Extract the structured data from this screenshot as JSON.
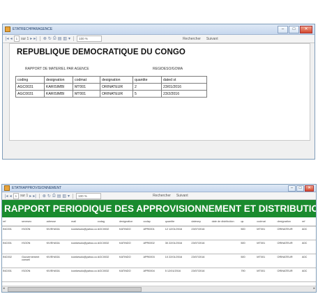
{
  "window1": {
    "title": "ETATRECHPARAGENCE",
    "toolbar": {
      "page_cur": "1",
      "page_total": "sur 1",
      "zoom": "100 %",
      "find": "Rechercher",
      "next": "Suivant"
    },
    "report": {
      "heading": "REPUBLIQUE DEMOCRATIQUE DU CONGO",
      "sub_left": "RAPPORT DE MATERIEL PAR AGENCE",
      "sub_right": "REGIDESO/GOMA",
      "columns": [
        "coding",
        "designation",
        "codmat",
        "designation",
        "quantite",
        "dated st"
      ],
      "rows": [
        [
          "AGC0031",
          "KARISIMBI",
          "MT001",
          "ORINATEUR",
          "2",
          "23/01/2016"
        ],
        [
          "AGC0031",
          "KARISIMBI",
          "MT001",
          "ORINATEUR",
          "5",
          "23/2/2016"
        ]
      ]
    }
  },
  "window2": {
    "title": "ETATRAPPROVISIONNEMENT",
    "toolbar": {
      "page_cur": "1",
      "page_total": "sur 1",
      "zoom": "100 %",
      "find": "Rechercher",
      "next": "Suivant"
    },
    "report": {
      "banner": "RAPPORT PERIODIQUE DES APPROVISIONNEMENT ET DISTRIBUTION DE MATERIEL",
      "columns": [
        "ref",
        "sexeseo",
        "adresse",
        "mail",
        "codag",
        "designation",
        "codap",
        "quantite",
        "datesep",
        "date de distribution",
        "qs",
        "codmat",
        "designation",
        "ref"
      ],
      "rows": [
        [
          "INC001",
          "ISOON",
          "KIVEHASA",
          "iconkesolo@yahoo.com",
          "AGC0032",
          "KATINDO",
          "APR0001",
          "12 12/01/2016",
          "23/07/2016",
          "",
          "500",
          "MT001",
          "ORINATEUR",
          "A0C"
        ],
        [
          "INC001",
          "ISOON",
          "KIVEHASA",
          "iconkesolo@yahoo.com",
          "AGC0032",
          "KATINDO",
          "APR0002",
          "30 22/01/2016",
          "23/07/2016",
          "",
          "500",
          "MT001",
          "ORINATEUR",
          "A0C"
        ],
        [
          "INC002",
          "Gouvernement conseil",
          "KIVEHASA",
          "iconkesolo@yahoo.com",
          "AGC0032",
          "KATINDO",
          "APR0003",
          "10 22/01/2016",
          "23/07/2016",
          "",
          "500",
          "MT001",
          "ORINATEUR",
          "A0C"
        ],
        [
          "INC001",
          "ISOON",
          "KIVEHASA",
          "iconkesolo@yahoo.com",
          "AGC0032",
          "KATINDO",
          "APR0004",
          "5 12/01/2016",
          "23/07/2016",
          "",
          "790",
          "MT001",
          "ORINATEUR",
          "A0C"
        ]
      ]
    }
  }
}
